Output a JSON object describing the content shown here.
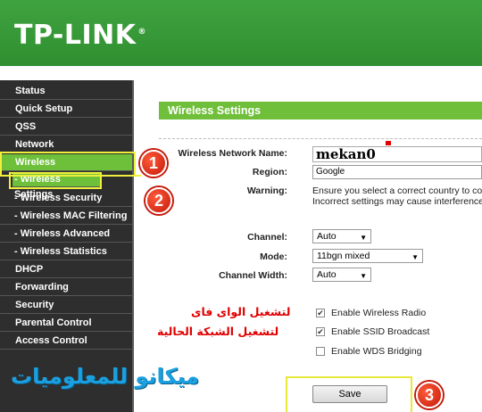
{
  "header": {
    "logo": "TP-LINK",
    "logo_mark": "®"
  },
  "sidebar": {
    "items": [
      {
        "label": "Status"
      },
      {
        "label": "Quick Setup"
      },
      {
        "label": "QSS"
      },
      {
        "label": "Network"
      },
      {
        "label": "Wireless"
      },
      {
        "label": "- Wireless Settings"
      },
      {
        "label": "- Wireless Security"
      },
      {
        "label": "- Wireless MAC Filtering"
      },
      {
        "label": "- Wireless Advanced"
      },
      {
        "label": "- Wireless Statistics"
      },
      {
        "label": "DHCP"
      },
      {
        "label": "Forwarding"
      },
      {
        "label": "Security"
      },
      {
        "label": "Parental Control"
      },
      {
        "label": "Access Control"
      }
    ]
  },
  "section": {
    "title": "Wireless Settings"
  },
  "form": {
    "ssid_label": "Wireless Network Name:",
    "ssid_value": "mekan0",
    "region_label": "Region:",
    "region_value": "Google",
    "warning_label": "Warning:",
    "warning_line1": "Ensure you select a correct country to conf",
    "warning_line2": "Incorrect settings may cause interference.",
    "channel_label": "Channel:",
    "channel_value": "Auto",
    "mode_label": "Mode:",
    "mode_value": "11bgn mixed",
    "width_label": "Channel Width:",
    "width_value": "Auto",
    "radio_label": "Enable Wireless Radio",
    "radio_checked": true,
    "ssid_broadcast_label": "Enable SSID Broadcast",
    "ssid_broadcast_checked": true,
    "wds_label": "Enable WDS Bridging",
    "wds_checked": false,
    "save_label": "Save"
  },
  "annotations": {
    "marker1": "1",
    "marker2": "2",
    "marker3": "3",
    "note_radio": "لتشغيل الواى فاى",
    "note_ssid": "لتشغيل الشبكة الحالية",
    "watermark": "ميكانو للمعلوميات"
  },
  "colors": {
    "header_green": "#3fa33f",
    "sidebar_bg": "#2e2e2e",
    "active_green": "#6ec03a",
    "marker_red": "#c41a0a",
    "highlight_yellow": "#f0f03c",
    "note_red": "#e00000",
    "watermark_blue": "#1aa0e0"
  }
}
